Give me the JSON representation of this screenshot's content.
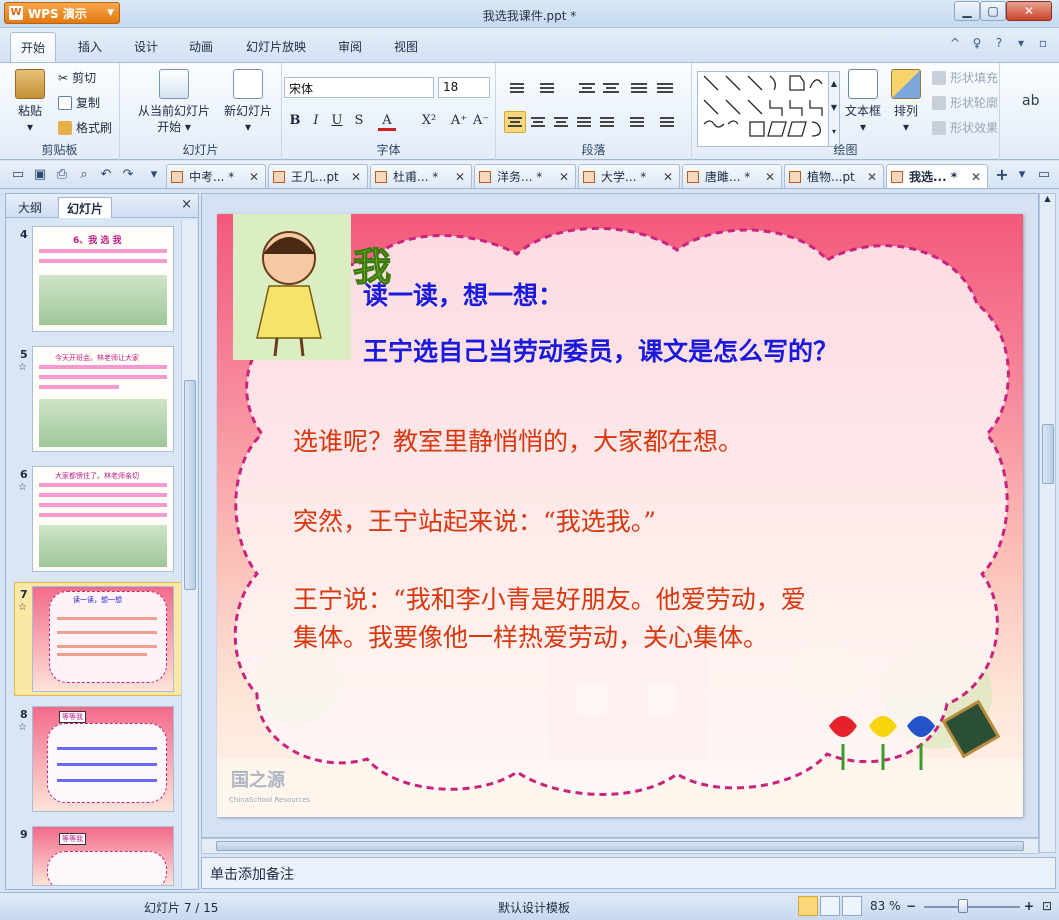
{
  "window": {
    "app_button": "WPS 演示",
    "title": "我选我课件.ppt *"
  },
  "ribbon_tabs": [
    "开始",
    "插入",
    "设计",
    "动画",
    "幻灯片放映",
    "审阅",
    "视图"
  ],
  "clipboard": {
    "paste": "粘贴",
    "cut": "剪切",
    "copy": "复制",
    "format_painter": "格式刷",
    "label": "剪贴板"
  },
  "slides_group": {
    "from_current": "从当前幻灯片",
    "from_current2": "开始",
    "new_slide": "新幻灯片",
    "label": "幻灯片"
  },
  "font_group": {
    "font_name": "宋体",
    "font_size": "18",
    "label": "字体"
  },
  "paragraph_group": {
    "label": "段落"
  },
  "drawing_group": {
    "text_box": "文本框",
    "arrange": "排列",
    "shape_fill": "形状填充",
    "shape_outline": "形状轮廓",
    "shape_effect": "形状效果",
    "label": "绘图"
  },
  "doc_tabs": [
    "中考... *",
    "王几...pt",
    "杜甫... *",
    "洋务... *",
    "大学... *",
    "唐雎... *",
    "植物...pt",
    "我选... *"
  ],
  "left_panel": {
    "tab_outline": "大纲",
    "tab_slides": "幻灯片",
    "close": "×"
  },
  "thumbnails": [
    {
      "num": "4",
      "star": "",
      "text": "6、我 选 我"
    },
    {
      "num": "5",
      "star": "☆",
      "text": "今天开班会。林老师让大家"
    },
    {
      "num": "6",
      "star": "☆",
      "text": "大家都愣住了。林老师亲切"
    },
    {
      "num": "7",
      "star": "☆",
      "text": "读一读，想一想"
    },
    {
      "num": "8",
      "star": "☆",
      "text": "等等我"
    },
    {
      "num": "9",
      "star": "",
      "text": "等等我"
    }
  ],
  "slide": {
    "title_char": "我",
    "question1": "读一读，想一想：",
    "question2": "王宁选自己当劳动委员，课文是怎么写的？",
    "para1": "选谁呢？教室里静悄悄的，大家都在想。",
    "para2": "突然，王宁站起来说：“我选我。”",
    "para3_line1": "王宁说：“我和李小青是好朋友。他爱劳动，爱",
    "para3_line2": "集体。我要像他一样热爱劳动，关心集体。",
    "watermark": "国之源",
    "watermark_sub": "ChinaSchool Resources"
  },
  "notes_placeholder": "单击添加备注",
  "status": {
    "slide_pos": "幻灯片 7 / 15",
    "template": "默认设计模板",
    "zoom": "83 %"
  },
  "colors": {
    "accent": "#e57a12",
    "question_blue": "#1a1adc",
    "body_red": "#d9380f",
    "bubble_border": "#c8237f"
  }
}
